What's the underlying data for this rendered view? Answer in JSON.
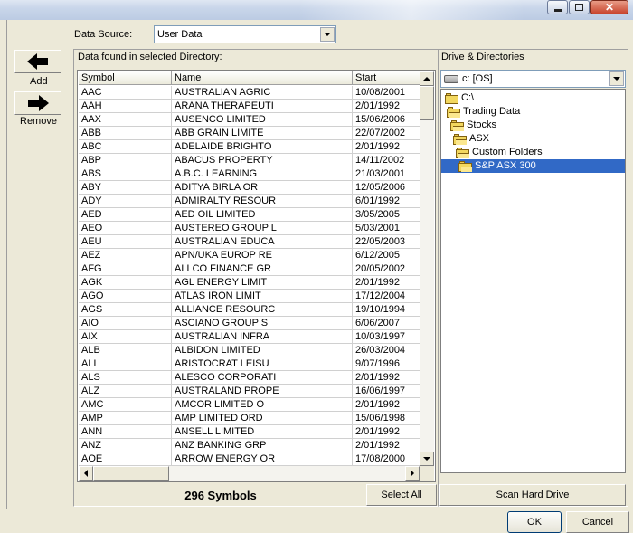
{
  "labels": {
    "data_source": "Data Source:",
    "data_found": "Data found in selected Directory:",
    "drive_dirs": "Drive & Directories"
  },
  "data_source": {
    "value": "User Data"
  },
  "side_buttons": {
    "add": "Add",
    "remove": "Remove"
  },
  "list": {
    "columns": [
      "Symbol",
      "Name",
      "Start"
    ],
    "rows": [
      [
        "AAC",
        "AUSTRALIAN AGRIC",
        "10/08/2001"
      ],
      [
        "AAH",
        "ARANA THERAPEUTI",
        "2/01/1992"
      ],
      [
        "AAX",
        "AUSENCO LIMITED",
        "15/06/2006"
      ],
      [
        "ABB",
        "ABB GRAIN LIMITE",
        "22/07/2002"
      ],
      [
        "ABC",
        "ADELAIDE BRIGHTO",
        "2/01/1992"
      ],
      [
        "ABP",
        "ABACUS PROPERTY",
        "14/11/2002"
      ],
      [
        "ABS",
        "A.B.C. LEARNING",
        "21/03/2001"
      ],
      [
        "ABY",
        "ADITYA BIRLA  OR",
        "12/05/2006"
      ],
      [
        "ADY",
        "ADMIRALTY RESOUR",
        "6/01/1992"
      ],
      [
        "AED",
        "AED OIL LIMITED",
        "3/05/2005"
      ],
      [
        "AEO",
        "AUSTEREO GROUP L",
        "5/03/2001"
      ],
      [
        "AEU",
        "AUSTRALIAN EDUCA",
        "22/05/2003"
      ],
      [
        "AEZ",
        "APN/UKA EUROP RE",
        "6/12/2005"
      ],
      [
        "AFG",
        "ALLCO FINANCE GR",
        "20/05/2002"
      ],
      [
        "AGK",
        "AGL ENERGY LIMIT",
        "2/01/1992"
      ],
      [
        "AGO",
        "ATLAS IRON LIMIT",
        "17/12/2004"
      ],
      [
        "AGS",
        "ALLIANCE RESOURC",
        "19/10/1994"
      ],
      [
        "AIO",
        "ASCIANO GROUP  S",
        "6/06/2007"
      ],
      [
        "AIX",
        "AUSTRALIAN INFRA",
        "10/03/1997"
      ],
      [
        "ALB",
        "ALBIDON LIMITED",
        "26/03/2004"
      ],
      [
        "ALL",
        "ARISTOCRAT LEISU",
        "9/07/1996"
      ],
      [
        "ALS",
        "ALESCO CORPORATI",
        "2/01/1992"
      ],
      [
        "ALZ",
        "AUSTRALAND PROPE",
        "16/06/1997"
      ],
      [
        "AMC",
        "AMCOR LIMITED  O",
        "2/01/1992"
      ],
      [
        "AMP",
        "AMP LIMITED  ORD",
        "15/06/1998"
      ],
      [
        "ANN",
        "ANSELL LIMITED",
        "2/01/1992"
      ],
      [
        "ANZ",
        "ANZ BANKING GRP",
        "2/01/1992"
      ],
      [
        "AOE",
        "ARROW ENERGY  OR",
        "17/08/2000"
      ]
    ]
  },
  "drive": {
    "value": "c: [OS]"
  },
  "tree": [
    {
      "label": "C:\\",
      "selected": false
    },
    {
      "label": "Trading Data",
      "selected": false
    },
    {
      "label": "Stocks",
      "selected": false
    },
    {
      "label": "ASX",
      "selected": false
    },
    {
      "label": "Custom Folders",
      "selected": false
    },
    {
      "label": "S&P ASX 300",
      "selected": true
    }
  ],
  "status": {
    "count": "296 Symbols"
  },
  "buttons": {
    "select_all": "Select All",
    "scan_drive": "Scan Hard Drive",
    "ok": "OK",
    "cancel": "Cancel"
  },
  "icons": [
    "arrow-left-icon",
    "arrow-right-icon",
    "drive-icon",
    "folder-icon",
    "chevron-down-icon"
  ]
}
